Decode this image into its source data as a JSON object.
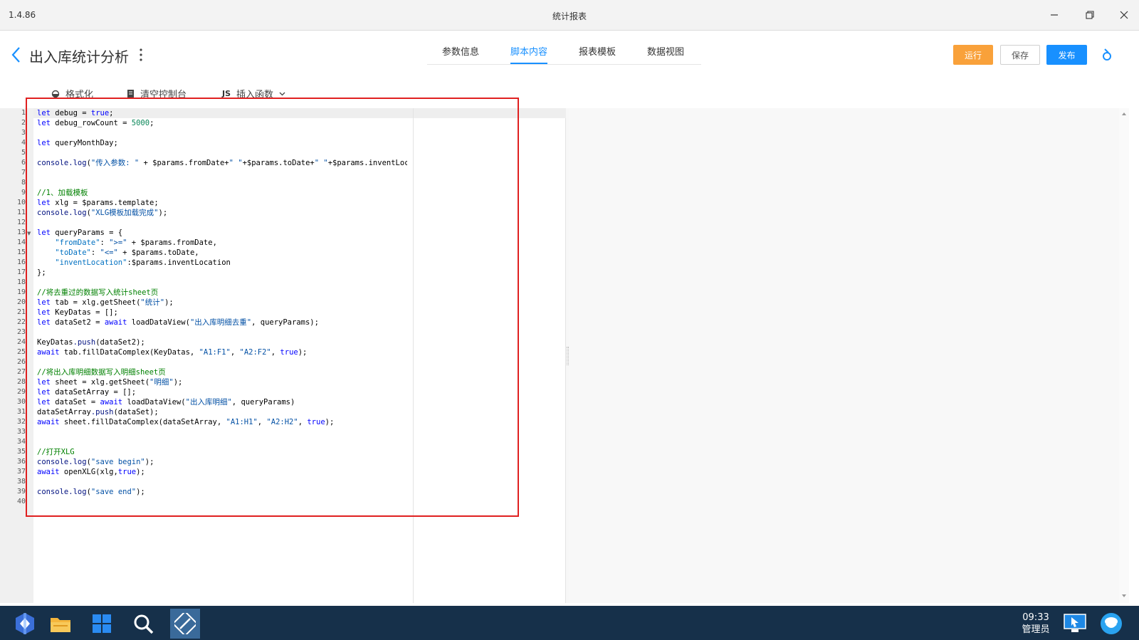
{
  "window": {
    "version": "1.4.86",
    "title": "统计报表"
  },
  "header": {
    "page_title": "出入库统计分析",
    "tabs": [
      {
        "label": "参数信息"
      },
      {
        "label": "脚本内容",
        "active": true
      },
      {
        "label": "报表模板"
      },
      {
        "label": "数据视图"
      }
    ],
    "buttons": {
      "run": "运行",
      "save": "保存",
      "publish": "发布"
    }
  },
  "toolbar": {
    "format": "格式化",
    "clear_console": "清空控制台",
    "js_label": "JS",
    "insert_function": "插入函数"
  },
  "editor": {
    "line_numbers": [
      "1",
      "2",
      "3",
      "4",
      "5",
      "6",
      "7",
      "8",
      "9",
      "10",
      "11",
      "12",
      "13",
      "14",
      "15",
      "16",
      "17",
      "18",
      "19",
      "20",
      "21",
      "22",
      "23",
      "24",
      "25",
      "26",
      "27",
      "28",
      "29",
      "30",
      "31",
      "32",
      "33",
      "34",
      "35",
      "36",
      "37",
      "38",
      "39",
      "40"
    ],
    "lines": [
      "let debug = true;",
      "let debug_rowCount = 5000;",
      "",
      "let queryMonthDay;",
      "",
      "console.log(\"传入参数: \" + $params.fromDate+\" \"+$params.toDate+\" \"+$params.inventLocation);",
      "",
      "",
      "//1、加载模板",
      "let xlg = $params.template;",
      "console.log(\"XLG模板加载完成\");",
      "",
      "let queryParams = {",
      "    \"fromDate\": \">=\" + $params.fromDate,",
      "    \"toDate\": \"<=\" + $params.toDate,",
      "    \"inventLocation\":$params.inventLocation",
      "};",
      "",
      "//将去重过的数据写入统计sheet页",
      "let tab = xlg.getSheet(\"统计\");",
      "let KeyDatas = [];",
      "let dataSet2 = await loadDataView(\"出入库明细去重\", queryParams);",
      "",
      "KeyDatas.push(dataSet2);",
      "await tab.fillDataComplex(KeyDatas, \"A1:F1\", \"A2:F2\", true);",
      "",
      "//将出入库明细数据写入明细sheet页",
      "let sheet = xlg.getSheet(\"明细\");",
      "let dataSetArray = [];",
      "let dataSet = await loadDataView(\"出入库明细\", queryParams)",
      "dataSetArray.push(dataSet);",
      "await sheet.fillDataComplex(dataSetArray, \"A1:H1\", \"A2:H2\", true);",
      "",
      "",
      "//打开XLG",
      "console.log(\"save begin\");",
      "await openXLG(xlg,true);",
      "",
      "console.log(\"save end\");",
      ""
    ]
  },
  "taskbar": {
    "time": "09:33",
    "user": "管理员"
  },
  "colors": {
    "primary": "#1890ff",
    "run_button": "#f9a13a",
    "highlight_border": "#e02020",
    "taskbar": "#16304a"
  }
}
